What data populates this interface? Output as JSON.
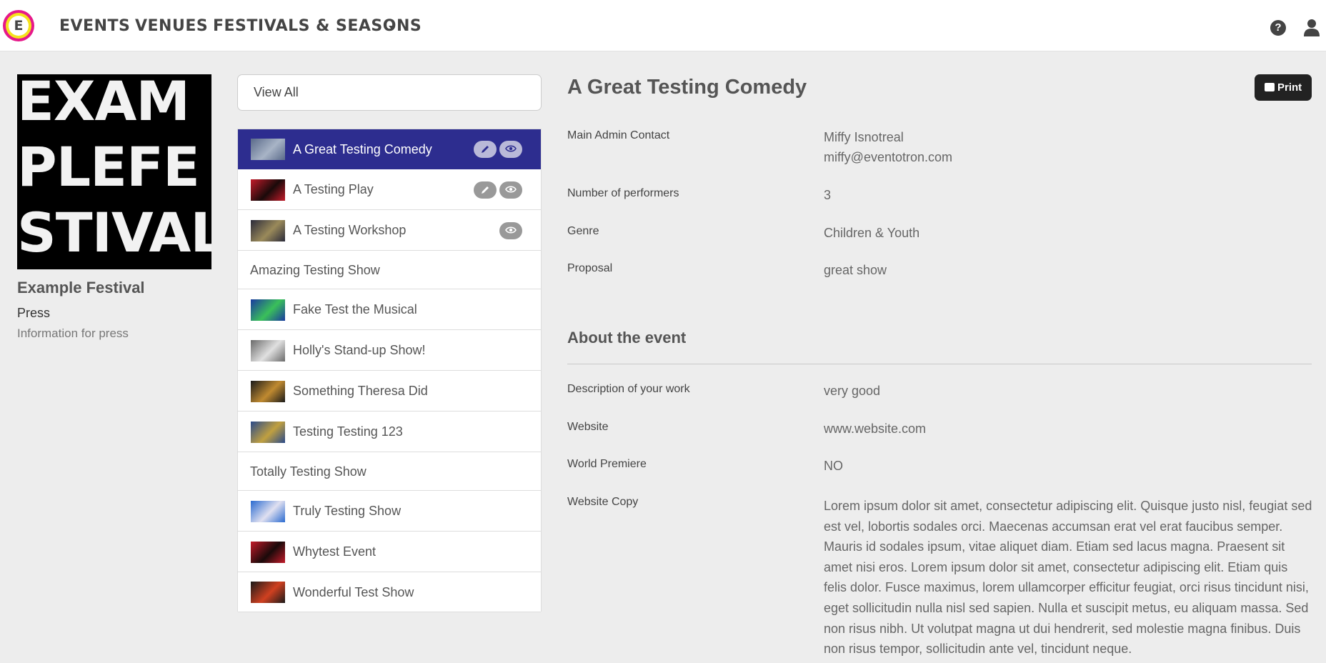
{
  "nav": {
    "logo_letter": "E",
    "items": [
      "EVENTS",
      "VENUES",
      "FESTIVALS & SEASONS"
    ],
    "icons": [
      "help-icon",
      "user-icon"
    ]
  },
  "festival": {
    "poster_lines": [
      "EXAM",
      "PLEFE",
      "STIVAL"
    ],
    "name": "Example Festival",
    "section_title": "Press",
    "section_subtitle": "Information for press"
  },
  "list": {
    "view_all": "View All",
    "events": [
      {
        "title": "A Great Testing Comedy",
        "thumb": true,
        "edit": true,
        "view": true,
        "active": true
      },
      {
        "title": "A Testing Play",
        "thumb": true,
        "edit": true,
        "view": true,
        "active": false
      },
      {
        "title": "A Testing Workshop",
        "thumb": true,
        "edit": false,
        "view": true,
        "active": false
      },
      {
        "title": "Amazing Testing Show",
        "thumb": false,
        "edit": false,
        "view": false,
        "active": false
      },
      {
        "title": "Fake Test the Musical",
        "thumb": true,
        "edit": false,
        "view": false,
        "active": false
      },
      {
        "title": "Holly's Stand-up Show!",
        "thumb": true,
        "edit": false,
        "view": false,
        "active": false
      },
      {
        "title": "Something Theresa Did",
        "thumb": true,
        "edit": false,
        "view": false,
        "active": false
      },
      {
        "title": "Testing Testing 123",
        "thumb": true,
        "edit": false,
        "view": false,
        "active": false
      },
      {
        "title": "Totally Testing Show",
        "thumb": false,
        "edit": false,
        "view": false,
        "active": false
      },
      {
        "title": "Truly Testing Show",
        "thumb": true,
        "edit": false,
        "view": false,
        "active": false
      },
      {
        "title": "Whytest Event",
        "thumb": true,
        "edit": false,
        "view": false,
        "active": false
      },
      {
        "title": "Wonderful Test Show",
        "thumb": true,
        "edit": false,
        "view": false,
        "active": false
      }
    ]
  },
  "detail": {
    "title": "A Great Testing Comedy",
    "print_label": "Print",
    "fields": [
      {
        "label": "Main Admin Contact",
        "value": "Miffy Isnotreal",
        "value2": "miffy@eventotron.com"
      },
      {
        "label": "Number of performers",
        "value": "3"
      },
      {
        "label": "Genre",
        "value": "Children & Youth"
      },
      {
        "label": "Proposal",
        "value": "great show"
      }
    ],
    "about_heading": "About the event",
    "about_fields": [
      {
        "label": "Description of your work",
        "value": "very good"
      },
      {
        "label": "Website",
        "value": "www.website.com"
      },
      {
        "label": "World Premiere",
        "value": "NO"
      },
      {
        "label": "Website Copy",
        "value": "Lorem ipsum dolor sit amet, consectetur adipiscing elit. Quisque justo nisl, feugiat sed est vel, lobortis sodales orci. Maecenas accumsan erat vel erat faucibus semper. Mauris id sodales ipsum, vitae aliquet diam. Etiam sed lacus magna. Praesent sit amet nisi eros. Lorem ipsum dolor sit amet, consectetur adipiscing elit. Etiam quis felis dolor. Fusce maximus, lorem ullamcorper efficitur feugiat, orci risus tincidunt nisi, eget sollicitudin nulla nisl sed sapien. Nulla et suscipit metus, eu aliquam massa. Sed non risus nibh. Ut volutpat magna ut dui hendrerit, sed molestie magna finibus. Duis non risus tempor, sollicitudin ante vel, tincidunt neque."
      }
    ]
  },
  "colors": {
    "active_row": "#2d2d8f",
    "logo_outer": "#e6198a",
    "logo_ring": "#f5e21c",
    "print_button": "#222222"
  }
}
